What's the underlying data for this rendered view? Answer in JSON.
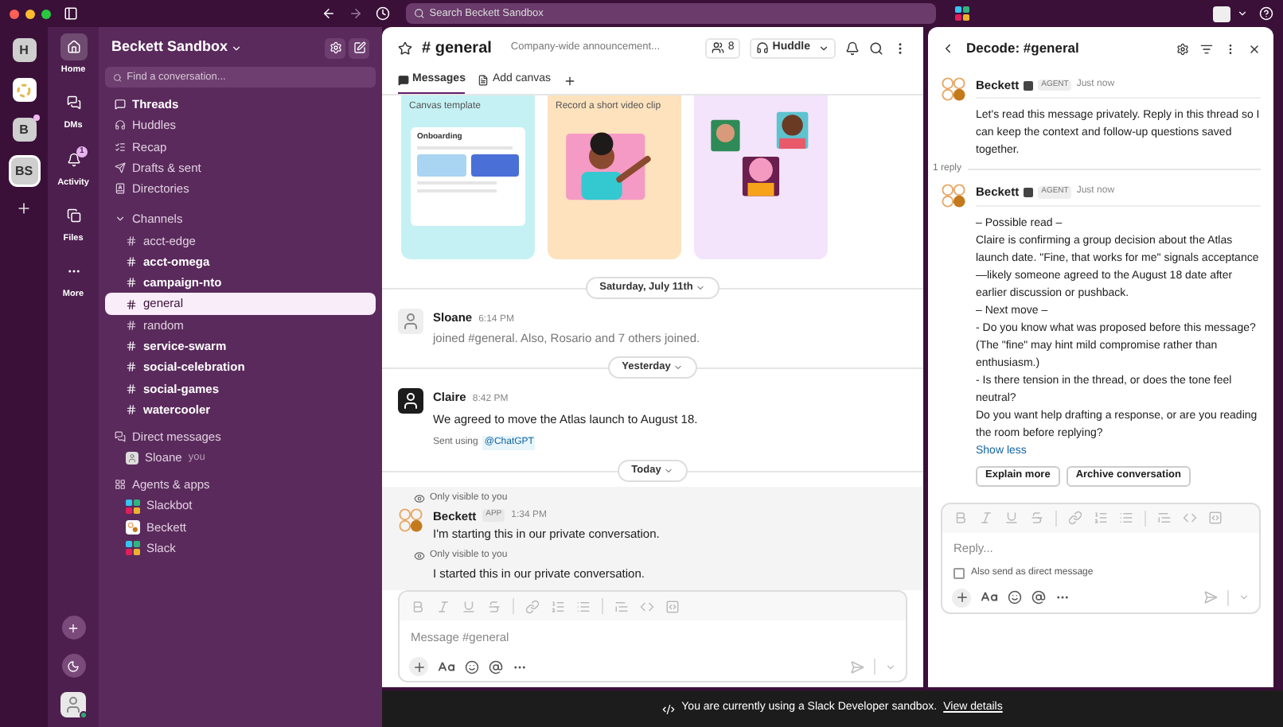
{
  "titlebar": {
    "search_placeholder": "Search Beckett Sandbox"
  },
  "workspaces": [
    {
      "kind": "letter",
      "label": "H",
      "selected": false,
      "unread": false
    },
    {
      "kind": "logo",
      "selected": false,
      "unread": false
    },
    {
      "kind": "letter",
      "label": "B",
      "selected": false,
      "unread": true
    },
    {
      "kind": "letter",
      "label": "BS",
      "selected": true,
      "unread": false
    }
  ],
  "nav": [
    {
      "kind": "home",
      "label": "Home",
      "selected": true
    },
    {
      "kind": "dms",
      "label": "DMs",
      "selected": false
    },
    {
      "kind": "activity",
      "label": "Activity",
      "selected": false,
      "badge": "1"
    },
    {
      "kind": "files",
      "label": "Files",
      "selected": false
    },
    {
      "kind": "more",
      "label": "More",
      "selected": false
    }
  ],
  "sidebar": {
    "workspace_name": "Beckett Sandbox",
    "search_placeholder": "Find a conversation...",
    "items": [
      {
        "kind": "threads",
        "label": "Threads",
        "unread": true
      },
      {
        "kind": "huddles",
        "label": "Huddles",
        "unread": false
      },
      {
        "kind": "recap",
        "label": "Recap",
        "unread": false
      },
      {
        "kind": "drafts",
        "label": "Drafts & sent",
        "unread": false
      },
      {
        "kind": "directories",
        "label": "Directories",
        "unread": false
      }
    ],
    "channels_heading": "Channels",
    "channels": [
      {
        "name": "acct-edge",
        "unread": false,
        "selected": false
      },
      {
        "name": "acct-omega",
        "unread": true,
        "selected": false
      },
      {
        "name": "campaign-nto",
        "unread": true,
        "selected": false
      },
      {
        "name": "general",
        "unread": false,
        "selected": true
      },
      {
        "name": "random",
        "unread": false,
        "selected": false
      },
      {
        "name": "service-swarm",
        "unread": true,
        "selected": false
      },
      {
        "name": "social-celebration",
        "unread": true,
        "selected": false
      },
      {
        "name": "social-games",
        "unread": true,
        "selected": false
      },
      {
        "name": "watercooler",
        "unread": true,
        "selected": false
      }
    ],
    "dm_heading": "Direct messages",
    "dms": [
      {
        "name": "Sloane",
        "note": "you"
      }
    ],
    "apps_heading": "Agents & apps",
    "apps": [
      {
        "kind": "slackbot",
        "name": "Slackbot"
      },
      {
        "kind": "beckett",
        "name": "Beckett"
      },
      {
        "kind": "slack",
        "name": "Slack"
      }
    ]
  },
  "channel": {
    "title": "# general",
    "description": "Company-wide announcement...",
    "member_count": "8",
    "huddle": "Huddle",
    "tabs": [
      {
        "kind": "messages",
        "label": "Messages",
        "selected": true
      },
      {
        "kind": "canvas",
        "label": "Add canvas",
        "selected": false
      }
    ],
    "cards": [
      {
        "kind": "template",
        "subtitle": "Canvas template",
        "doc_title": "Onboarding"
      },
      {
        "kind": "video",
        "subtitle": "Record a short video clip"
      },
      {
        "kind": "team"
      }
    ],
    "timeline": [
      {
        "kind": "divider",
        "label": "Saturday, July 11th"
      },
      {
        "kind": "system",
        "author": "Sloane",
        "time": "6:14 PM",
        "text": "joined #general. Also, Rosario and 7 others joined."
      },
      {
        "kind": "divider",
        "label": "Yesterday"
      },
      {
        "kind": "message",
        "author": "Claire",
        "time": "8:42 PM",
        "text": "We agreed to move the Atlas launch to August 18.",
        "footer": "Sent using",
        "footer_link": "@ChatGPT"
      },
      {
        "kind": "divider",
        "label": "Today"
      },
      {
        "kind": "ephemeral",
        "note": "Only visible to you",
        "author": "Beckett",
        "badge": "APP",
        "time": "1:34 PM",
        "text": "I'm starting this in our private conversation."
      },
      {
        "kind": "ephemeral_followup",
        "note": "Only visible to you",
        "text": "I started this in our private conversation."
      }
    ],
    "composer_placeholder": "Message #general"
  },
  "thread": {
    "title": "Decode: #general",
    "root": {
      "author": "Beckett",
      "badge": "AGENT",
      "time": "Just now",
      "text": "Let's read this message privately. Reply in this thread so I can keep the context and follow-up questions saved together."
    },
    "reply_count": "1 reply",
    "reply": {
      "author": "Beckett",
      "badge": "AGENT",
      "time": "Just now",
      "lines": [
        "– Possible read –",
        "Claire is confirming a group decision about the Atlas launch date. \"Fine, that works for me\" signals acceptance—likely someone agreed to the August 18 date after earlier discussion or pushback.",
        "– Next move –",
        "- Do you know what was proposed before this message? (The \"fine\" may hint mild compromise rather than enthusiasm.)",
        "- Is there tension in the thread, or does the tone feel neutral?",
        "Do you want help drafting a response, or are you reading the room before replying?"
      ],
      "show_less": "Show less",
      "buttons": [
        "Explain more",
        "Archive conversation"
      ]
    },
    "composer_placeholder": "Reply...",
    "also_send": {
      "label": "Also send as direct message",
      "checked": false
    }
  },
  "banner": {
    "text": "You are currently using a Slack Developer sandbox.",
    "link": "View details"
  }
}
